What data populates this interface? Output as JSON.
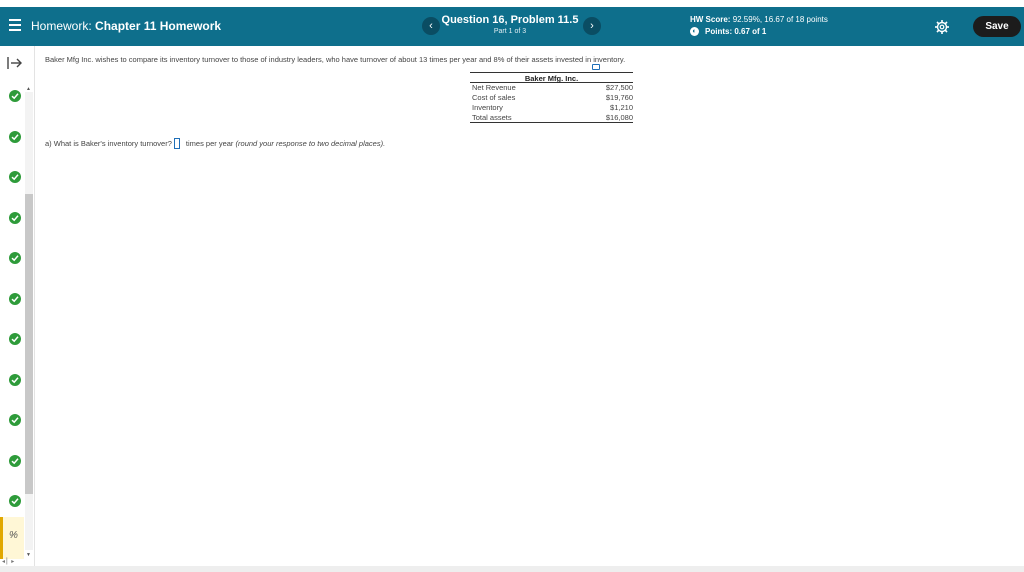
{
  "header": {
    "hw_label": "Homework:",
    "hw_name": "Chapter 11 Homework",
    "question_title": "Question 16, Problem 11.5",
    "part_label": "Part 1 of 3",
    "prev_glyph": "‹",
    "next_glyph": "›",
    "score_label": "HW Score:",
    "score_value": "92.59%, 16.67 of 18 points",
    "points_label": "Points:",
    "points_value": "0.67 of 1",
    "save_label": "Save"
  },
  "rail": {
    "items": [
      {
        "status": "correct"
      },
      {
        "status": "correct"
      },
      {
        "status": "correct"
      },
      {
        "status": "correct"
      },
      {
        "status": "correct"
      },
      {
        "status": "correct"
      },
      {
        "status": "correct"
      },
      {
        "status": "correct"
      },
      {
        "status": "correct"
      },
      {
        "status": "correct"
      },
      {
        "status": "correct"
      }
    ],
    "current_icon_text": "%",
    "nav_text": "◂ ▏▸"
  },
  "problem": {
    "intro": "Baker Mfg Inc. wishes to compare its inventory turnover to those of industry leaders, who have turnover of about 13 times per year and 8% of their assets invested in inventory.",
    "table": {
      "caption": "Baker Mfg. Inc.",
      "rows": [
        {
          "label": "Net Revenue",
          "value": "$27,500"
        },
        {
          "label": "Cost of sales",
          "value": "$19,760"
        },
        {
          "label": "Inventory",
          "value": "$1,210"
        },
        {
          "label": "Total assets",
          "value": "$16,080"
        }
      ]
    },
    "question_a": "a) What is Baker's inventory turnover?",
    "answer_value": "",
    "unit_text": "times per year",
    "hint": "(round your response to two decimal places)."
  },
  "colors": {
    "header_bg": "#0e6f8c",
    "correct": "#2e9b3a",
    "save_bg": "#1c1c1c"
  }
}
